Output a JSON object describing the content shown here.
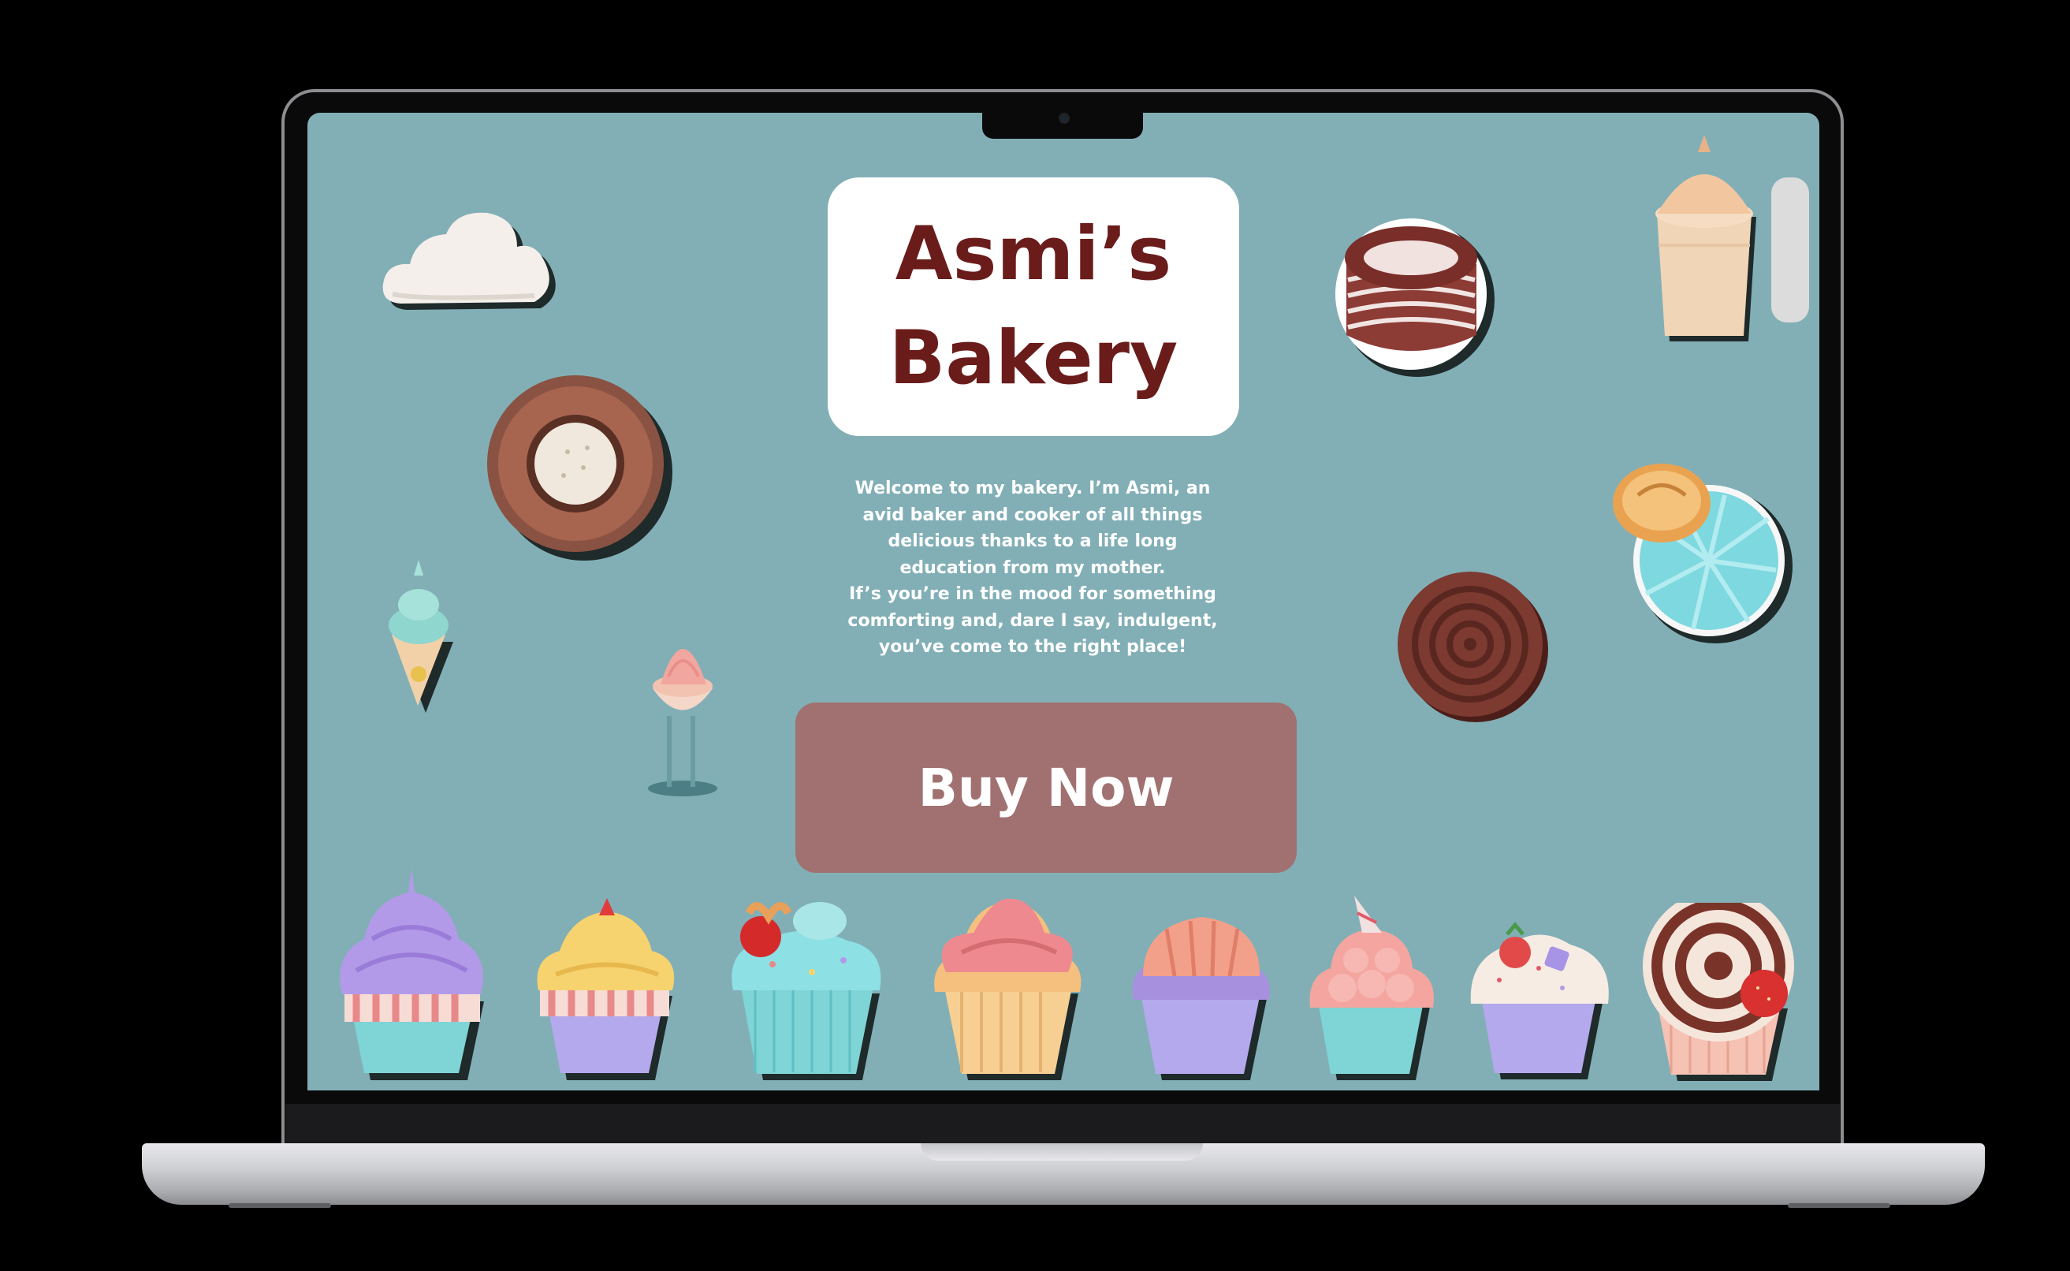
{
  "site": {
    "title_line1": "Asmi’s",
    "title_line2": "Bakery",
    "intro_paragraph1": "Welcome to my bakery. I’m Asmi, an avid baker and cooker of all things delicious thanks to a life long education from my mother.",
    "intro_paragraph2": "If’s you’re in the mood for something comforting and, dare I say, indulgent, you’ve come to the right place!",
    "buy_button_label": "Buy Now"
  },
  "colors": {
    "page_background": "#82afb6",
    "title_text": "#6a1c1b",
    "button_background": "#a07170",
    "button_text": "#ffffff",
    "card_background": "#ffffff"
  },
  "decorations": [
    "cloud-icon",
    "donut-icon",
    "ice-cream-cone-icon",
    "parfait-glass-icon",
    "chocolate-cake-icon",
    "milkshake-icon",
    "cookie-pie-icon",
    "chocolate-swirl-cookie-icon",
    "purple-cupcake-icon",
    "yellow-cupcake-icon",
    "teal-strawberry-cupcake-icon",
    "pink-cupcake-icon",
    "salmon-purple-cupcake-icon",
    "pink-frosted-cupcake-icon",
    "cream-strawberry-cupcake-icon",
    "swirl-strawberry-cupcake-icon"
  ]
}
